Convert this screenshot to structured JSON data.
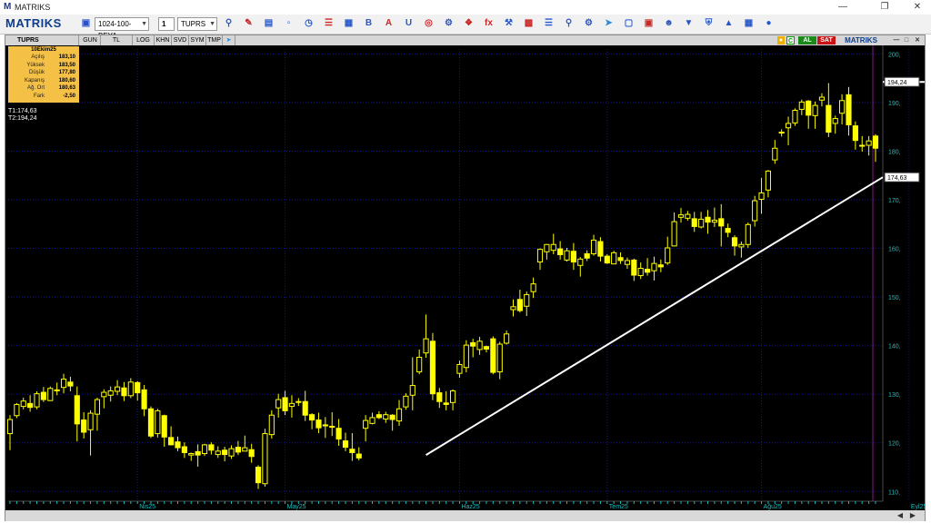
{
  "window": {
    "app_icon": "M",
    "title": "MATRIKS"
  },
  "toolbar": {
    "logo_a": "MATRI",
    "logo_b": "KS",
    "template": "1024-100-BEYA",
    "slot": "1",
    "symbol": "TUPRS",
    "icons": [
      "save-icon",
      "zoom-icon",
      "pencil-icon",
      "indicator-icon",
      "window-icon",
      "clock-icon",
      "list-icon",
      "grid-icon",
      "bold-icon",
      "text-icon",
      "magnet-icon",
      "target-icon",
      "system-icon",
      "chart-icon",
      "fx-icon",
      "tools-icon",
      "table-icon",
      "book-icon",
      "search-icon",
      "settings-icon",
      "twitter-icon",
      "screen-icon",
      "image-icon",
      "user-icon",
      "filter-icon",
      "shield-icon",
      "bell-icon",
      "calculator-icon",
      "drop-icon"
    ]
  },
  "chart_window": {
    "symbol_tab": "TUPRS",
    "period_tabs": [
      "GUN",
      "TL",
      "LOG",
      "KHN",
      "SVD",
      "SYM",
      "TMP"
    ],
    "right_buttons": {
      "c": "C",
      "al": "AL",
      "sat": "SAT",
      "brand": "MATRIKS"
    }
  },
  "infobox": {
    "date": "10Ekim25",
    "rows": [
      {
        "label": "Açılış",
        "value": "183,10"
      },
      {
        "label": "Yüksek",
        "value": "183,50"
      },
      {
        "label": "Düşük",
        "value": "177,80"
      },
      {
        "label": "Kapanış",
        "value": "180,60"
      },
      {
        "label": "Ağ. Ort",
        "value": "180,63"
      },
      {
        "label": "Fark",
        "value": "-2,50"
      }
    ]
  },
  "trend_labels": {
    "t1": "T1:174,63",
    "t2": "T2:194,24"
  },
  "colors": {
    "candle": "#ffff00",
    "grid": "#1414a0",
    "line": "#ffffff",
    "axis_text": "#19c0c0",
    "background": "#000000"
  },
  "chart_data": {
    "type": "candlestick",
    "symbol": "TUPRS",
    "y_ticks": [
      "200,",
      "190,",
      "180,",
      "170,",
      "160,",
      "150,",
      "140,",
      "130,",
      "120,",
      "110,"
    ],
    "y_tick_values": [
      200,
      190,
      180,
      170,
      160,
      150,
      140,
      130,
      120,
      110
    ],
    "ylim": [
      108,
      201
    ],
    "x_labels": [
      "Nis25",
      "May25",
      "Haz25",
      "Tem25",
      "Ağu25",
      "Eyl25",
      "Eki25"
    ],
    "x_label_index": [
      19,
      41,
      67,
      89,
      112,
      134,
      158
    ],
    "price_tags": [
      {
        "label": "194,24",
        "value": 194.24
      },
      {
        "label": "174,63",
        "value": 174.63
      }
    ],
    "horizontal_line": {
      "value": 194.24,
      "from_index": 146
    },
    "trendline": {
      "from_index": 62,
      "from_value": 117.5,
      "to_index": 166,
      "to_value": 174.63
    },
    "grid": true,
    "candles": [
      [
        121.9,
        125.7,
        118.5,
        124.8
      ],
      [
        125.6,
        128.2,
        125.1,
        127.9
      ],
      [
        127.5,
        129.3,
        126.9,
        128.6
      ],
      [
        128.1,
        129.8,
        126.4,
        127.3
      ],
      [
        127.4,
        130.6,
        126.9,
        130.1
      ],
      [
        130.4,
        131.5,
        128.4,
        128.9
      ],
      [
        128.7,
        131.6,
        128.6,
        131.2
      ],
      [
        130.9,
        132.4,
        129.8,
        130.7
      ],
      [
        131.4,
        134.2,
        130.2,
        133.1
      ],
      [
        132.5,
        133.6,
        130.6,
        131.7
      ],
      [
        129.7,
        131.6,
        120.3,
        123.9
      ],
      [
        124.7,
        126.3,
        120.9,
        122.2
      ],
      [
        122.7,
        126.7,
        117.4,
        126.1
      ],
      [
        125.9,
        129.3,
        122.5,
        128.9
      ],
      [
        129.5,
        131.0,
        127.1,
        130.4
      ],
      [
        129.8,
        131.6,
        128.5,
        130.7
      ],
      [
        130.6,
        132.9,
        129.8,
        131.5
      ],
      [
        131.3,
        132.5,
        128.6,
        129.7
      ],
      [
        129.7,
        133.3,
        129.2,
        132.5
      ],
      [
        132.4,
        132.7,
        128.7,
        130.3
      ],
      [
        130.9,
        131.9,
        125.5,
        127.0
      ],
      [
        127.0,
        127.5,
        121.0,
        121.4
      ],
      [
        121.9,
        127.0,
        121.1,
        126.6
      ],
      [
        125.6,
        125.8,
        119.2,
        121.2
      ],
      [
        121.1,
        123.4,
        119.5,
        119.6
      ],
      [
        120.2,
        121.3,
        118.3,
        119.0
      ],
      [
        119.2,
        120.1,
        116.9,
        118.0
      ],
      [
        117.5,
        118.0,
        116.3,
        117.8
      ],
      [
        118.2,
        119.7,
        115.1,
        117.5
      ],
      [
        117.8,
        119.8,
        117.3,
        119.6
      ],
      [
        119.6,
        120.1,
        117.6,
        118.5
      ],
      [
        117.6,
        119.3,
        116.9,
        118.3
      ],
      [
        118.5,
        119.2,
        116.2,
        117.6
      ],
      [
        117.3,
        119.5,
        116.7,
        118.8
      ],
      [
        119.1,
        120.4,
        117.5,
        118.1
      ],
      [
        118.3,
        121.5,
        118.3,
        119.0
      ],
      [
        118.6,
        119.8,
        115.9,
        117.2
      ],
      [
        115.0,
        115.4,
        110.5,
        111.8
      ],
      [
        111.6,
        122.9,
        111.0,
        121.9
      ],
      [
        121.7,
        126.7,
        120.9,
        125.7
      ],
      [
        127.2,
        130.1,
        125.2,
        128.9
      ],
      [
        129.3,
        130.7,
        125.7,
        126.6
      ],
      [
        127.5,
        129.8,
        125.2,
        128.1
      ],
      [
        128.4,
        129.2,
        127.6,
        128.5
      ],
      [
        128.5,
        130.7,
        124.5,
        125.7
      ],
      [
        125.8,
        126.1,
        122.8,
        124.7
      ],
      [
        124.7,
        126.2,
        122.0,
        123.1
      ],
      [
        123.7,
        125.3,
        121.0,
        123.5
      ],
      [
        123.3,
        126.3,
        121.4,
        123.4
      ],
      [
        123.0,
        124.9,
        119.4,
        120.8
      ],
      [
        120.4,
        122.1,
        118.3,
        119.1
      ],
      [
        118.7,
        122.0,
        116.3,
        118.0
      ],
      [
        117.7,
        119.1,
        116.4,
        116.9
      ],
      [
        123.0,
        125.7,
        120.3,
        124.6
      ],
      [
        124.0,
        126.2,
        123.8,
        125.2
      ],
      [
        125.8,
        126.5,
        124.9,
        125.2
      ],
      [
        124.9,
        126.4,
        124.1,
        125.8
      ],
      [
        125.7,
        125.9,
        122.5,
        124.8
      ],
      [
        124.5,
        128.8,
        123.5,
        127.0
      ],
      [
        127.4,
        130.2,
        126.8,
        129.6
      ],
      [
        129.8,
        137.6,
        126.7,
        131.8
      ],
      [
        134.6,
        139.2,
        134.1,
        137.6
      ],
      [
        138.5,
        146.4,
        137.5,
        141.4
      ],
      [
        140.9,
        142.6,
        128.8,
        130.1
      ],
      [
        130.3,
        131.3,
        127.2,
        128.5
      ],
      [
        128.2,
        130.6,
        126.7,
        127.9
      ],
      [
        128.3,
        131.0,
        126.7,
        130.7
      ],
      [
        134.3,
        136.9,
        133.4,
        136.1
      ],
      [
        135.5,
        141.1,
        134.5,
        140.1
      ],
      [
        140.6,
        141.4,
        137.6,
        139.9
      ],
      [
        139.2,
        141.8,
        138.1,
        140.9
      ],
      [
        139.8,
        140.0,
        138.6,
        139.3
      ],
      [
        141.4,
        141.9,
        134.1,
        134.5
      ],
      [
        134.6,
        140.8,
        133.1,
        140.3
      ],
      [
        140.5,
        143.1,
        140.2,
        142.4
      ],
      [
        147.4,
        149.5,
        146.0,
        148.0
      ],
      [
        149.5,
        151.5,
        146.8,
        147.2
      ],
      [
        148.1,
        151.1,
        146.1,
        150.5
      ],
      [
        151.1,
        154.0,
        149.8,
        152.7
      ],
      [
        157.2,
        160.0,
        155.6,
        159.8
      ],
      [
        159.3,
        160.9,
        157.7,
        160.8
      ],
      [
        159.6,
        163.0,
        158.8,
        160.8
      ],
      [
        159.9,
        161.5,
        157.7,
        158.7
      ],
      [
        157.6,
        160.1,
        157.3,
        159.5
      ],
      [
        159.4,
        161.1,
        155.6,
        157.2
      ],
      [
        156.5,
        158.2,
        154.2,
        157.8
      ],
      [
        158.9,
        159.6,
        157.4,
        158.0
      ],
      [
        158.9,
        162.8,
        158.5,
        161.7
      ],
      [
        161.4,
        162.3,
        157.3,
        158.4
      ],
      [
        158.4,
        158.8,
        156.8,
        157.0
      ],
      [
        156.8,
        159.5,
        156.8,
        159.1
      ],
      [
        158.1,
        159.2,
        156.8,
        157.5
      ],
      [
        156.7,
        158.1,
        155.8,
        157.5
      ],
      [
        157.6,
        157.9,
        153.3,
        154.5
      ],
      [
        154.4,
        157.1,
        153.7,
        155.9
      ],
      [
        155.7,
        158.0,
        154.4,
        155.1
      ],
      [
        155.4,
        158.3,
        153.4,
        156.9
      ],
      [
        156.6,
        157.7,
        155.1,
        156.2
      ],
      [
        157.0,
        162.4,
        156.6,
        160.1
      ],
      [
        160.5,
        167.4,
        160.4,
        165.5
      ],
      [
        166.4,
        168.3,
        165.3,
        166.9
      ],
      [
        166.2,
        167.7,
        165.7,
        167.0
      ],
      [
        166.1,
        167.5,
        163.4,
        164.5
      ],
      [
        164.4,
        167.5,
        164.1,
        166.0
      ],
      [
        166.4,
        167.9,
        163.0,
        165.4
      ],
      [
        165.4,
        168.4,
        164.4,
        165.8
      ],
      [
        166.1,
        169.1,
        160.4,
        164.6
      ],
      [
        164.1,
        165.1,
        162.3,
        163.3
      ],
      [
        162.2,
        162.7,
        158.5,
        160.5
      ],
      [
        160.3,
        161.4,
        158.1,
        160.8
      ],
      [
        160.8,
        165.3,
        160.1,
        164.9
      ],
      [
        165.7,
        170.8,
        164.5,
        169.8
      ],
      [
        170.1,
        174.5,
        167.1,
        171.4
      ],
      [
        172.0,
        176.1,
        170.5,
        175.9
      ],
      [
        178.2,
        182.3,
        177.4,
        180.6
      ],
      [
        183.9,
        184.5,
        183.0,
        183.8
      ],
      [
        184.8,
        187.1,
        181.2,
        185.7
      ],
      [
        185.8,
        188.8,
        185.2,
        188.4
      ],
      [
        188.6,
        190.6,
        187.4,
        190.1
      ],
      [
        190.3,
        190.5,
        184.6,
        187.4
      ],
      [
        187.3,
        190.2,
        184.6,
        189.4
      ],
      [
        190.5,
        191.9,
        189.2,
        191.1
      ],
      [
        189.4,
        194.0,
        182.9,
        183.9
      ],
      [
        185.7,
        187.3,
        183.6,
        186.7
      ],
      [
        187.8,
        191.7,
        185.5,
        190.4
      ],
      [
        191.6,
        193.2,
        183.2,
        185.4
      ],
      [
        185.2,
        186.1,
        180.3,
        182.2
      ],
      [
        181.2,
        183.1,
        179.9,
        181.2
      ],
      [
        181.2,
        183.1,
        179.1,
        182.1
      ],
      [
        183.1,
        183.5,
        177.8,
        180.6
      ]
    ]
  }
}
